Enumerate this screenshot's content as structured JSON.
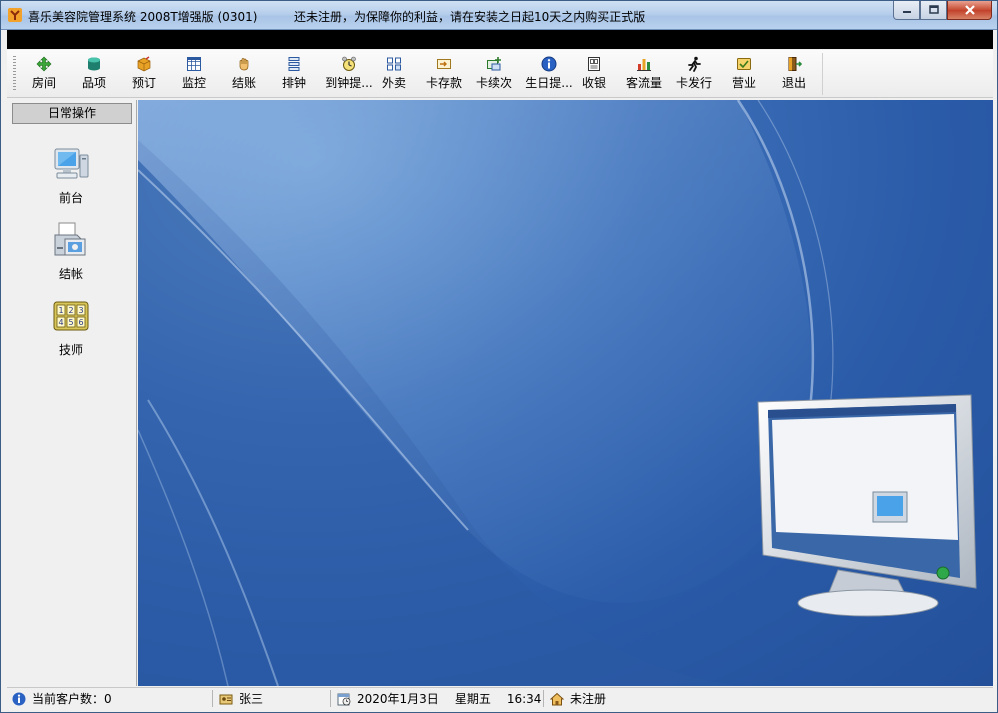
{
  "window": {
    "title": "喜乐美容院管理系统  2008T增强版 (0301)",
    "notice": "还未注册，为保障你的利益，请在安装之日起10天之内购买正式版"
  },
  "toolbar": {
    "items": [
      {
        "label": "房间",
        "icon": "room-icon"
      },
      {
        "label": "品项",
        "icon": "product-icon"
      },
      {
        "label": "预订",
        "icon": "booking-icon"
      },
      {
        "label": "监控",
        "icon": "monitor-grid-icon"
      },
      {
        "label": "结账",
        "icon": "checkout-hand-icon"
      },
      {
        "label": "排钟",
        "icon": "schedule-icon"
      },
      {
        "label": "到钟提...",
        "icon": "alarm-clock-icon"
      },
      {
        "label": "外卖",
        "icon": "takeout-icon"
      },
      {
        "label": "卡存款",
        "icon": "card-deposit-icon"
      },
      {
        "label": "卡续次",
        "icon": "card-renew-icon"
      },
      {
        "label": "生日提...",
        "icon": "info-icon"
      },
      {
        "label": "收银",
        "icon": "cashier-icon"
      },
      {
        "label": "客流量",
        "icon": "bar-chart-icon"
      },
      {
        "label": "卡发行",
        "icon": "running-man-icon"
      },
      {
        "label": "营业",
        "icon": "business-icon"
      },
      {
        "label": "退出",
        "icon": "exit-door-icon"
      }
    ]
  },
  "sidebar": {
    "header": "日常操作",
    "items": [
      {
        "label": "前台",
        "icon": "computer-icon"
      },
      {
        "label": "结帐",
        "icon": "printer-icon"
      },
      {
        "label": "技师",
        "icon": "number-pad-icon"
      }
    ]
  },
  "statusbar": {
    "customers": "当前客户数：0",
    "user": "张三",
    "date": "2020年1月3日",
    "weekday": "星期五",
    "time": "16:34",
    "registration": "未注册"
  },
  "colors": {
    "desktop": "#2a5ba8",
    "titlebar": "#b7cfec",
    "close_button": "#c74b32"
  }
}
